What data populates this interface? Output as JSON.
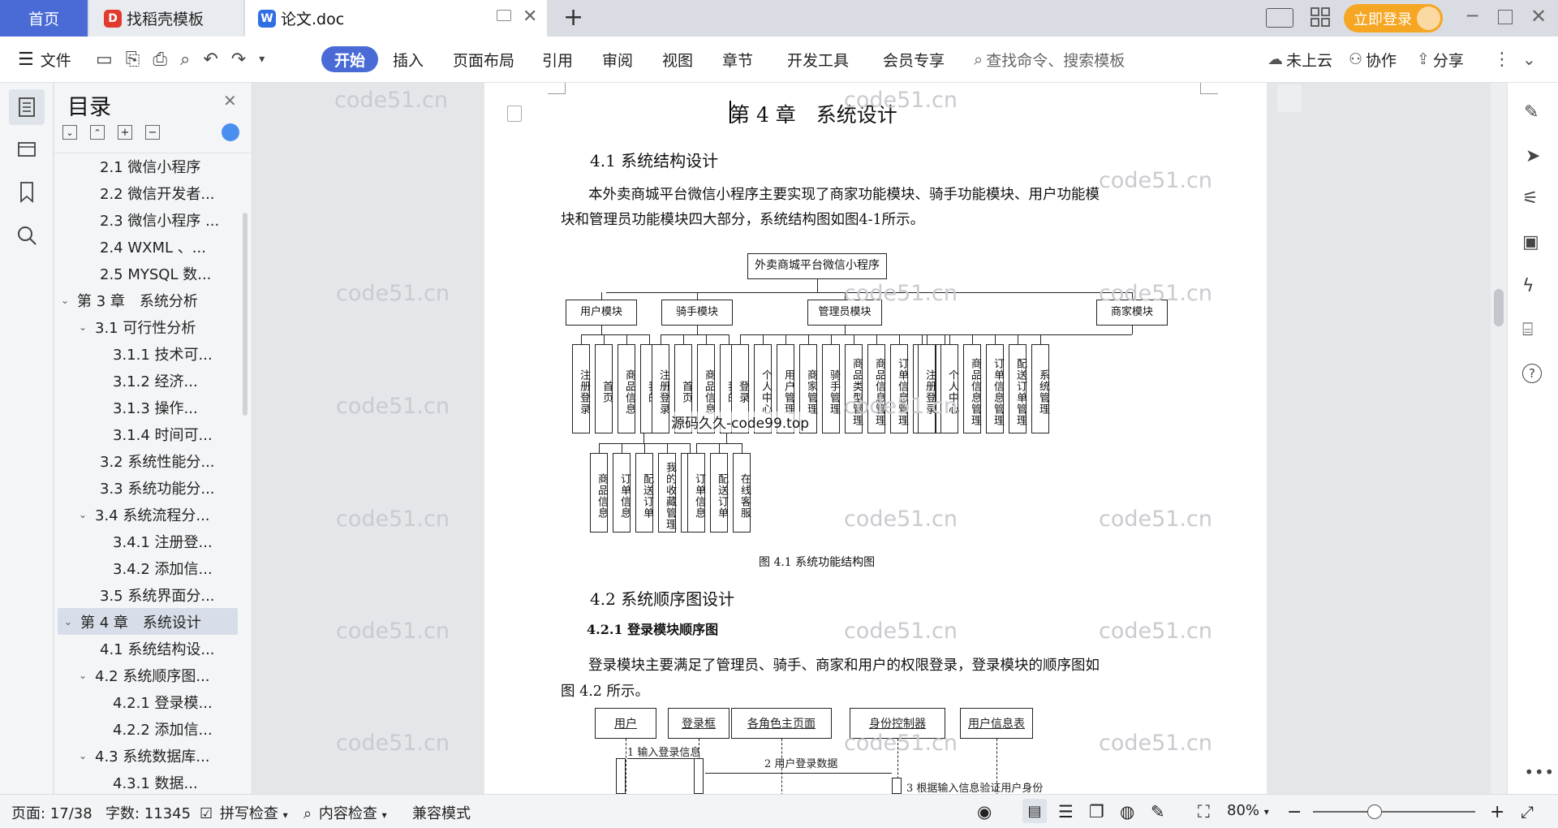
{
  "tabs": {
    "home": "首页",
    "doc1": "找稻壳模板",
    "doc2": "论文.doc",
    "add": "+",
    "login": "立即登录"
  },
  "toolbar": {
    "file": "文件",
    "start": "开始",
    "insert": "插入",
    "layout": "页面布局",
    "reference": "引用",
    "review": "审阅",
    "view": "视图",
    "chapter": "章节",
    "devtools": "开发工具",
    "vip": "会员专享",
    "search_placeholder": "查找命令、搜索模板",
    "cloud": "未上云",
    "collab": "协作",
    "share": "分享"
  },
  "outline": {
    "title": "目录",
    "items": [
      {
        "label": "2.1 微信小程序",
        "level": 2,
        "expand": ""
      },
      {
        "label": "2.2 微信开发者...",
        "level": 2,
        "expand": ""
      },
      {
        "label": "2.3 微信小程序 ...",
        "level": 2,
        "expand": ""
      },
      {
        "label": "2.4 WXML 、...",
        "level": 2,
        "expand": ""
      },
      {
        "label": "2.5 MYSQL 数...",
        "level": 2,
        "expand": ""
      },
      {
        "label": "第 3 章　系统分析",
        "level": 1,
        "expand": "v"
      },
      {
        "label": "3.1 可行性分析",
        "level": 2,
        "expand": "v"
      },
      {
        "label": "3.1.1 技术可...",
        "level": 3,
        "expand": ""
      },
      {
        "label": "3.1.2 经济...",
        "level": 3,
        "expand": ""
      },
      {
        "label": "3.1.3 操作...",
        "level": 3,
        "expand": ""
      },
      {
        "label": "3.1.4 时间可...",
        "level": 3,
        "expand": ""
      },
      {
        "label": "3.2 系统性能分...",
        "level": 2,
        "expand": ""
      },
      {
        "label": "3.3 系统功能分...",
        "level": 2,
        "expand": ""
      },
      {
        "label": "3.4 系统流程分...",
        "level": 2,
        "expand": "v"
      },
      {
        "label": "3.4.1 注册登...",
        "level": 3,
        "expand": ""
      },
      {
        "label": "3.4.2 添加信...",
        "level": 3,
        "expand": ""
      },
      {
        "label": "3.5 系统界面分...",
        "level": 2,
        "expand": ""
      },
      {
        "label": "第 4 章　系统设计",
        "level": 1,
        "expand": "v",
        "selected": true
      },
      {
        "label": "4.1 系统结构设...",
        "level": 2,
        "expand": ""
      },
      {
        "label": "4.2 系统顺序图...",
        "level": 2,
        "expand": "v"
      },
      {
        "label": "4.2.1 登录模...",
        "level": 3,
        "expand": ""
      },
      {
        "label": "4.2.2 添加信...",
        "level": 3,
        "expand": ""
      },
      {
        "label": "4.3 系统数据库...",
        "level": 2,
        "expand": "v"
      },
      {
        "label": "4.3.1 数据...",
        "level": 3,
        "expand": ""
      }
    ]
  },
  "doc": {
    "chapter_title": "第 4 章　系统设计",
    "sec41": "4.1 系统结构设计",
    "para1_line1": "本外卖商城平台微信小程序主要实现了商家功能模块、骑手功能模块、用户功能模",
    "para1_line2": "块和管理员功能模块四大部分，系统结构图如图4-1所示。",
    "fig1_caption": "图 4.1 系统功能结构图",
    "sec42": "4.2 系统顺序图设计",
    "sec421": "4.2.1 登录模块顺序图",
    "para2_line1": "登录模块主要满足了管理员、骑手、商家和用户的权限登录，登录模块的顺序图如",
    "para2_line2": "图  4.2  所示。",
    "overlay_text": "源码久久-code99.top"
  },
  "diagram": {
    "root": "外卖商城平台微信小程序",
    "modules": [
      "用户模块",
      "骑手模块",
      "管理员模块",
      "商家模块"
    ],
    "user_children": [
      "注册登录",
      "首页",
      "商品信息",
      "我的"
    ],
    "rider_children": [
      "注册登录",
      "首页",
      "商品信息",
      "我的"
    ],
    "admin_children": [
      "登录",
      "个人中心",
      "用户管理",
      "商家管理",
      "骑手管理",
      "商品类型管理",
      "商品信息管理",
      "订单信息管理",
      "配送订单管理",
      "系统管理"
    ],
    "merchant_children": [
      "注册登录",
      "个人中心",
      "商品信息管理",
      "订单信息管理",
      "配送订单管理",
      "系统管理"
    ],
    "user_sub": [
      "商品信息",
      "订单信息",
      "配送订单",
      "我的收藏管理",
      "在线客服"
    ],
    "rider_sub": [
      "订单信息",
      "配送订单",
      "在线客服"
    ]
  },
  "sequence": {
    "actors": [
      "用户",
      "登录框",
      "各角色主页面",
      "身份控制器",
      "用户信息表"
    ],
    "messages": [
      "1 输入登录信息",
      "2 用户登录数据",
      "3 根据输入信息验证用户身份"
    ]
  },
  "watermark": "code51.cn",
  "status": {
    "page": "页面: 17/38",
    "words": "字数: 11345",
    "spell": "拼写检查",
    "content_check": "内容检查",
    "compat": "兼容模式",
    "zoom": "80%"
  },
  "colors": {
    "accent": "#4a6bd6",
    "login": "#f5a623"
  }
}
